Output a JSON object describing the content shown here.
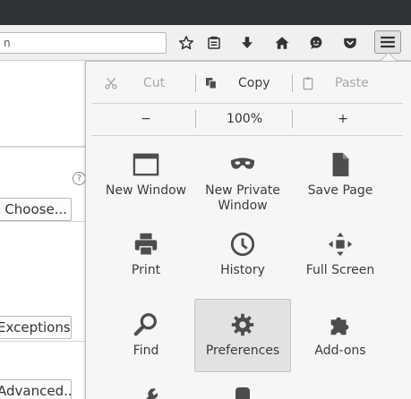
{
  "toolbar": {
    "url_value": "n",
    "icons": [
      "bookmark-star-icon",
      "reading-list-icon",
      "downloads-icon",
      "home-icon",
      "chat-icon",
      "pocket-icon",
      "hamburger-menu-icon"
    ]
  },
  "background_page": {
    "help_glyph": "?",
    "choose_button": "Choose...",
    "exceptions_button": "Exceptions...",
    "advanced_button": "Advanced..."
  },
  "menu": {
    "edit": {
      "cut": "Cut",
      "copy": "Copy",
      "paste": "Paste"
    },
    "zoom": {
      "out": "−",
      "level": "100%",
      "in": "+"
    },
    "items": [
      {
        "label": "New Window",
        "icon": "window-icon"
      },
      {
        "label": "New Private Window",
        "icon": "mask-icon"
      },
      {
        "label": "Save Page",
        "icon": "document-icon"
      },
      {
        "label": "Print",
        "icon": "printer-icon"
      },
      {
        "label": "History",
        "icon": "clock-icon"
      },
      {
        "label": "Full Screen",
        "icon": "fullscreen-icon"
      },
      {
        "label": "Find",
        "icon": "magnifier-icon"
      },
      {
        "label": "Preferences",
        "icon": "gear-icon"
      },
      {
        "label": "Add-ons",
        "icon": "puzzle-icon"
      }
    ]
  },
  "colors": {
    "icon": "#4d4d4d",
    "disabled": "#a8a8a8",
    "panel_bg": "#f6f6f6",
    "hover_bg": "#e2e2e2"
  }
}
